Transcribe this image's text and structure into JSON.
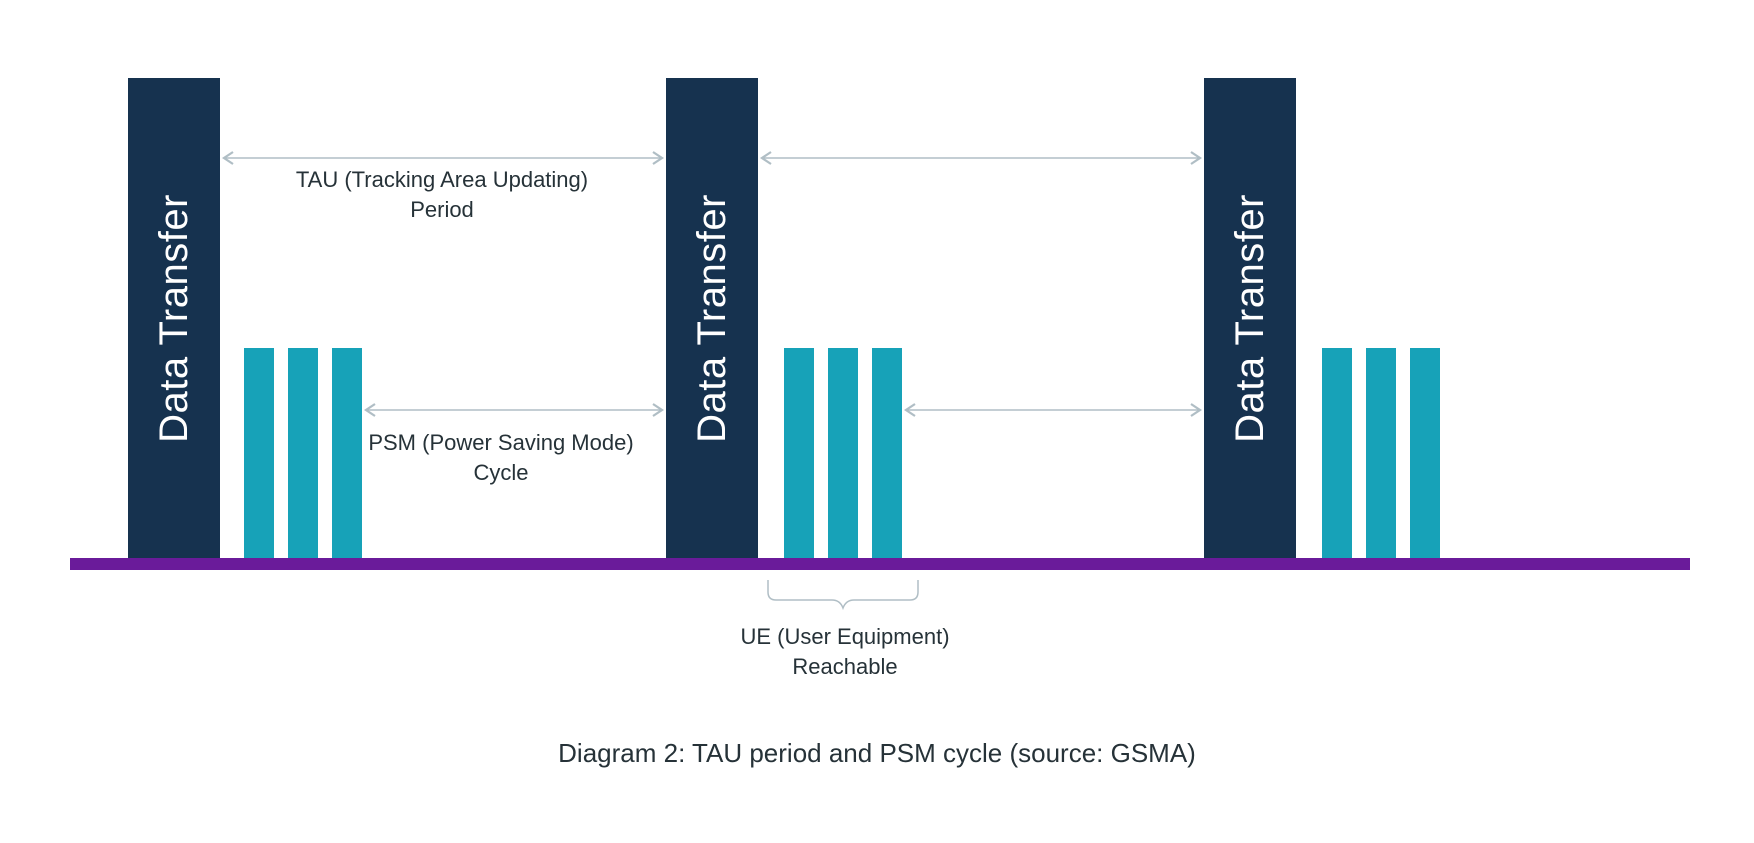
{
  "colors": {
    "tall_bar": "#16324f",
    "pulse_bar": "#17a2b8",
    "baseline": "#6a1b9a",
    "arrow": "#b0bec5",
    "text": "#263238"
  },
  "bars": {
    "data_transfer_label": "Data Transfer"
  },
  "labels": {
    "tau_line1": "TAU (Tracking Area Updating)",
    "tau_line2": "Period",
    "psm_line1": "PSM (Power Saving Mode)",
    "psm_line2": "Cycle",
    "ue_line1": "UE (User Equipment)",
    "ue_line2": "Reachable"
  },
  "caption": "Diagram 2: TAU period and PSM cycle (source: GSMA)",
  "chart_data": {
    "type": "diagram",
    "description": "Timing diagram showing three repeated cycles on a horizontal timeline. Each cycle consists of one tall 'Data Transfer' block followed by three short pulse bars during which the UE (User Equipment) is reachable. The span from the start of one Data Transfer block to the start of the next is labeled the TAU (Tracking Area Updating) Period. The span from the end of the short pulse group to the start of the next Data Transfer block is labeled the PSM (Power Saving Mode) Cycle.",
    "timeline_units": "relative",
    "events_per_cycle": [
      {
        "name": "Data Transfer",
        "relative_height": 1.0
      },
      {
        "name": "UE Reachable pulse 1",
        "relative_height": 0.44
      },
      {
        "name": "UE Reachable pulse 2",
        "relative_height": 0.44
      },
      {
        "name": "UE Reachable pulse 3",
        "relative_height": 0.44
      }
    ],
    "cycles_shown": 3,
    "intervals": [
      {
        "name": "TAU (Tracking Area Updating) Period",
        "from": "Data Transfer start (cycle N)",
        "to": "Data Transfer start (cycle N+1)"
      },
      {
        "name": "PSM (Power Saving Mode) Cycle",
        "from": "last UE-Reachable pulse end (cycle N)",
        "to": "Data Transfer start (cycle N+1)"
      },
      {
        "name": "UE (User Equipment) Reachable",
        "spans": "the three short pulse bars immediately after each Data Transfer block"
      }
    ],
    "source": "GSMA"
  }
}
